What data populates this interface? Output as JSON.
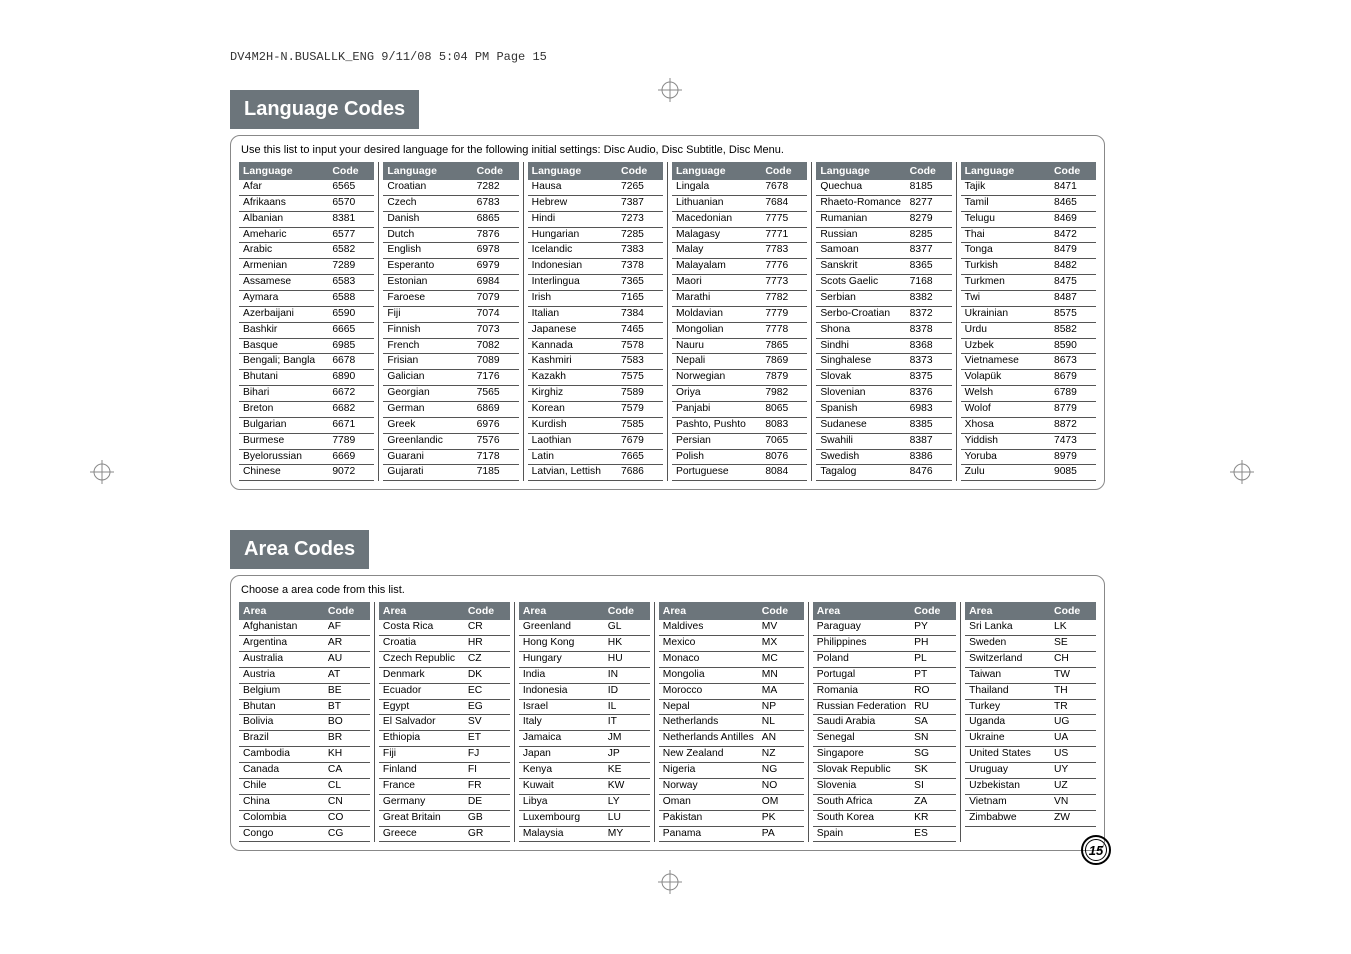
{
  "header_line": "DV4M2H-N.BUSALLK_ENG  9/11/08  5:04 PM  Page 15",
  "page_number": "15",
  "lang": {
    "title": "Language Codes",
    "intro": "Use this list to input your desired language for the following initial settings: Disc Audio, Disc Subtitle, Disc Menu.",
    "col_label_name": "Language",
    "col_label_code": "Code",
    "cols": [
      [
        {
          "n": "Afar",
          "c": "6565"
        },
        {
          "n": "Afrikaans",
          "c": "6570"
        },
        {
          "n": "Albanian",
          "c": "8381"
        },
        {
          "n": "Ameharic",
          "c": "6577"
        },
        {
          "n": "Arabic",
          "c": "6582"
        },
        {
          "n": "Armenian",
          "c": "7289"
        },
        {
          "n": "Assamese",
          "c": "6583"
        },
        {
          "n": "Aymara",
          "c": "6588"
        },
        {
          "n": "Azerbaijani",
          "c": "6590"
        },
        {
          "n": "Bashkir",
          "c": "6665"
        },
        {
          "n": "Basque",
          "c": "6985"
        },
        {
          "n": "Bengali; Bangla",
          "c": "6678"
        },
        {
          "n": "Bhutani",
          "c": "6890"
        },
        {
          "n": "Bihari",
          "c": "6672"
        },
        {
          "n": "Breton",
          "c": "6682"
        },
        {
          "n": "Bulgarian",
          "c": "6671"
        },
        {
          "n": "Burmese",
          "c": "7789"
        },
        {
          "n": "Byelorussian",
          "c": "6669"
        },
        {
          "n": "Chinese",
          "c": "9072"
        }
      ],
      [
        {
          "n": "Croatian",
          "c": "7282"
        },
        {
          "n": "Czech",
          "c": "6783"
        },
        {
          "n": "Danish",
          "c": "6865"
        },
        {
          "n": "Dutch",
          "c": "7876"
        },
        {
          "n": "English",
          "c": "6978"
        },
        {
          "n": "Esperanto",
          "c": "6979"
        },
        {
          "n": "Estonian",
          "c": "6984"
        },
        {
          "n": "Faroese",
          "c": "7079"
        },
        {
          "n": "Fiji",
          "c": "7074"
        },
        {
          "n": "Finnish",
          "c": "7073"
        },
        {
          "n": "French",
          "c": "7082"
        },
        {
          "n": "Frisian",
          "c": "7089"
        },
        {
          "n": "Galician",
          "c": "7176"
        },
        {
          "n": "Georgian",
          "c": "7565"
        },
        {
          "n": "German",
          "c": "6869"
        },
        {
          "n": "Greek",
          "c": "6976"
        },
        {
          "n": "Greenlandic",
          "c": "7576"
        },
        {
          "n": "Guarani",
          "c": "7178"
        },
        {
          "n": "Gujarati",
          "c": "7185"
        }
      ],
      [
        {
          "n": "Hausa",
          "c": "7265"
        },
        {
          "n": "Hebrew",
          "c": "7387"
        },
        {
          "n": "Hindi",
          "c": "7273"
        },
        {
          "n": "Hungarian",
          "c": "7285"
        },
        {
          "n": "Icelandic",
          "c": "7383"
        },
        {
          "n": "Indonesian",
          "c": "7378"
        },
        {
          "n": "Interlingua",
          "c": "7365"
        },
        {
          "n": "Irish",
          "c": "7165"
        },
        {
          "n": "Italian",
          "c": "7384"
        },
        {
          "n": "Japanese",
          "c": "7465"
        },
        {
          "n": "Kannada",
          "c": "7578"
        },
        {
          "n": "Kashmiri",
          "c": "7583"
        },
        {
          "n": "Kazakh",
          "c": "7575"
        },
        {
          "n": "Kirghiz",
          "c": "7589"
        },
        {
          "n": "Korean",
          "c": "7579"
        },
        {
          "n": "Kurdish",
          "c": "7585"
        },
        {
          "n": "Laothian",
          "c": "7679"
        },
        {
          "n": "Latin",
          "c": "7665"
        },
        {
          "n": "Latvian, Lettish",
          "c": "7686"
        }
      ],
      [
        {
          "n": "Lingala",
          "c": "7678"
        },
        {
          "n": "Lithuanian",
          "c": "7684"
        },
        {
          "n": "Macedonian",
          "c": "7775"
        },
        {
          "n": "Malagasy",
          "c": "7771"
        },
        {
          "n": "Malay",
          "c": "7783"
        },
        {
          "n": "Malayalam",
          "c": "7776"
        },
        {
          "n": "Maori",
          "c": "7773"
        },
        {
          "n": "Marathi",
          "c": "7782"
        },
        {
          "n": "Moldavian",
          "c": "7779"
        },
        {
          "n": "Mongolian",
          "c": "7778"
        },
        {
          "n": "Nauru",
          "c": "7865"
        },
        {
          "n": "Nepali",
          "c": "7869"
        },
        {
          "n": "Norwegian",
          "c": "7879"
        },
        {
          "n": "Oriya",
          "c": "7982"
        },
        {
          "n": "Panjabi",
          "c": "8065"
        },
        {
          "n": "Pashto, Pushto",
          "c": "8083"
        },
        {
          "n": "Persian",
          "c": "7065"
        },
        {
          "n": "Polish",
          "c": "8076"
        },
        {
          "n": "Portuguese",
          "c": "8084"
        }
      ],
      [
        {
          "n": "Quechua",
          "c": "8185"
        },
        {
          "n": "Rhaeto-Romance",
          "c": "8277"
        },
        {
          "n": "Rumanian",
          "c": "8279"
        },
        {
          "n": "Russian",
          "c": "8285"
        },
        {
          "n": "Samoan",
          "c": "8377"
        },
        {
          "n": "Sanskrit",
          "c": "8365"
        },
        {
          "n": "Scots Gaelic",
          "c": "7168"
        },
        {
          "n": "Serbian",
          "c": "8382"
        },
        {
          "n": "Serbo-Croatian",
          "c": "8372"
        },
        {
          "n": "Shona",
          "c": "8378"
        },
        {
          "n": "Sindhi",
          "c": "8368"
        },
        {
          "n": "Singhalese",
          "c": "8373"
        },
        {
          "n": "Slovak",
          "c": "8375"
        },
        {
          "n": "Slovenian",
          "c": "8376"
        },
        {
          "n": "Spanish",
          "c": "6983"
        },
        {
          "n": "Sudanese",
          "c": "8385"
        },
        {
          "n": "Swahili",
          "c": "8387"
        },
        {
          "n": "Swedish",
          "c": "8386"
        },
        {
          "n": "Tagalog",
          "c": "8476"
        }
      ],
      [
        {
          "n": "Tajik",
          "c": "8471"
        },
        {
          "n": "Tamil",
          "c": "8465"
        },
        {
          "n": "Telugu",
          "c": "8469"
        },
        {
          "n": "Thai",
          "c": "8472"
        },
        {
          "n": "Tonga",
          "c": "8479"
        },
        {
          "n": "Turkish",
          "c": "8482"
        },
        {
          "n": "Turkmen",
          "c": "8475"
        },
        {
          "n": "Twi",
          "c": "8487"
        },
        {
          "n": "Ukrainian",
          "c": "8575"
        },
        {
          "n": "Urdu",
          "c": "8582"
        },
        {
          "n": "Uzbek",
          "c": "8590"
        },
        {
          "n": "Vietnamese",
          "c": "8673"
        },
        {
          "n": "Volapük",
          "c": "8679"
        },
        {
          "n": "Welsh",
          "c": "6789"
        },
        {
          "n": "Wolof",
          "c": "8779"
        },
        {
          "n": "Xhosa",
          "c": "8872"
        },
        {
          "n": "Yiddish",
          "c": "7473"
        },
        {
          "n": "Yoruba",
          "c": "8979"
        },
        {
          "n": "Zulu",
          "c": "9085"
        }
      ]
    ]
  },
  "area": {
    "title": "Area Codes",
    "intro": "Choose a area code from this list.",
    "col_label_name": "Area",
    "col_label_code": "Code",
    "cols": [
      [
        {
          "n": "Afghanistan",
          "c": "AF"
        },
        {
          "n": "Argentina",
          "c": "AR"
        },
        {
          "n": "Australia",
          "c": "AU"
        },
        {
          "n": "Austria",
          "c": "AT"
        },
        {
          "n": "Belgium",
          "c": "BE"
        },
        {
          "n": "Bhutan",
          "c": "BT"
        },
        {
          "n": "Bolivia",
          "c": "BO"
        },
        {
          "n": "Brazil",
          "c": "BR"
        },
        {
          "n": "Cambodia",
          "c": "KH"
        },
        {
          "n": "Canada",
          "c": "CA"
        },
        {
          "n": "Chile",
          "c": "CL"
        },
        {
          "n": "China",
          "c": "CN"
        },
        {
          "n": "Colombia",
          "c": "CO"
        },
        {
          "n": "Congo",
          "c": "CG"
        }
      ],
      [
        {
          "n": "Costa Rica",
          "c": "CR"
        },
        {
          "n": "Croatia",
          "c": "HR"
        },
        {
          "n": "Czech Republic",
          "c": "CZ"
        },
        {
          "n": "Denmark",
          "c": "DK"
        },
        {
          "n": "Ecuador",
          "c": "EC"
        },
        {
          "n": "Egypt",
          "c": "EG"
        },
        {
          "n": "El Salvador",
          "c": "SV"
        },
        {
          "n": "Ethiopia",
          "c": "ET"
        },
        {
          "n": "Fiji",
          "c": "FJ"
        },
        {
          "n": "Finland",
          "c": "FI"
        },
        {
          "n": "France",
          "c": "FR"
        },
        {
          "n": "Germany",
          "c": "DE"
        },
        {
          "n": "Great Britain",
          "c": "GB"
        },
        {
          "n": "Greece",
          "c": "GR"
        }
      ],
      [
        {
          "n": "Greenland",
          "c": "GL"
        },
        {
          "n": "Hong Kong",
          "c": "HK"
        },
        {
          "n": "Hungary",
          "c": "HU"
        },
        {
          "n": "India",
          "c": "IN"
        },
        {
          "n": "Indonesia",
          "c": "ID"
        },
        {
          "n": "Israel",
          "c": "IL"
        },
        {
          "n": "Italy",
          "c": "IT"
        },
        {
          "n": "Jamaica",
          "c": "JM"
        },
        {
          "n": "Japan",
          "c": "JP"
        },
        {
          "n": "Kenya",
          "c": "KE"
        },
        {
          "n": "Kuwait",
          "c": "KW"
        },
        {
          "n": "Libya",
          "c": "LY"
        },
        {
          "n": "Luxembourg",
          "c": "LU"
        },
        {
          "n": "Malaysia",
          "c": "MY"
        }
      ],
      [
        {
          "n": "Maldives",
          "c": "MV"
        },
        {
          "n": "Mexico",
          "c": "MX"
        },
        {
          "n": "Monaco",
          "c": "MC"
        },
        {
          "n": "Mongolia",
          "c": "MN"
        },
        {
          "n": "Morocco",
          "c": "MA"
        },
        {
          "n": "Nepal",
          "c": "NP"
        },
        {
          "n": "Netherlands",
          "c": "NL"
        },
        {
          "n": "Netherlands Antilles",
          "c": "AN"
        },
        {
          "n": "New Zealand",
          "c": "NZ"
        },
        {
          "n": "Nigeria",
          "c": "NG"
        },
        {
          "n": "Norway",
          "c": "NO"
        },
        {
          "n": "Oman",
          "c": "OM"
        },
        {
          "n": "Pakistan",
          "c": "PK"
        },
        {
          "n": "Panama",
          "c": "PA"
        }
      ],
      [
        {
          "n": "Paraguay",
          "c": "PY"
        },
        {
          "n": "Philippines",
          "c": "PH"
        },
        {
          "n": "Poland",
          "c": "PL"
        },
        {
          "n": "Portugal",
          "c": "PT"
        },
        {
          "n": "Romania",
          "c": "RO"
        },
        {
          "n": "Russian Federation",
          "c": "RU"
        },
        {
          "n": "Saudi Arabia",
          "c": "SA"
        },
        {
          "n": "Senegal",
          "c": "SN"
        },
        {
          "n": "Singapore",
          "c": "SG"
        },
        {
          "n": "Slovak Republic",
          "c": "SK"
        },
        {
          "n": "Slovenia",
          "c": "SI"
        },
        {
          "n": "South Africa",
          "c": "ZA"
        },
        {
          "n": "South Korea",
          "c": "KR"
        },
        {
          "n": "Spain",
          "c": "ES"
        }
      ],
      [
        {
          "n": "Sri Lanka",
          "c": "LK"
        },
        {
          "n": "Sweden",
          "c": "SE"
        },
        {
          "n": "Switzerland",
          "c": "CH"
        },
        {
          "n": "Taiwan",
          "c": "TW"
        },
        {
          "n": "Thailand",
          "c": "TH"
        },
        {
          "n": "Turkey",
          "c": "TR"
        },
        {
          "n": "Uganda",
          "c": "UG"
        },
        {
          "n": "Ukraine",
          "c": "UA"
        },
        {
          "n": "United States",
          "c": "US"
        },
        {
          "n": "Uruguay",
          "c": "UY"
        },
        {
          "n": "Uzbekistan",
          "c": "UZ"
        },
        {
          "n": "Vietnam",
          "c": "VN"
        },
        {
          "n": "Zimbabwe",
          "c": "ZW"
        }
      ]
    ]
  }
}
